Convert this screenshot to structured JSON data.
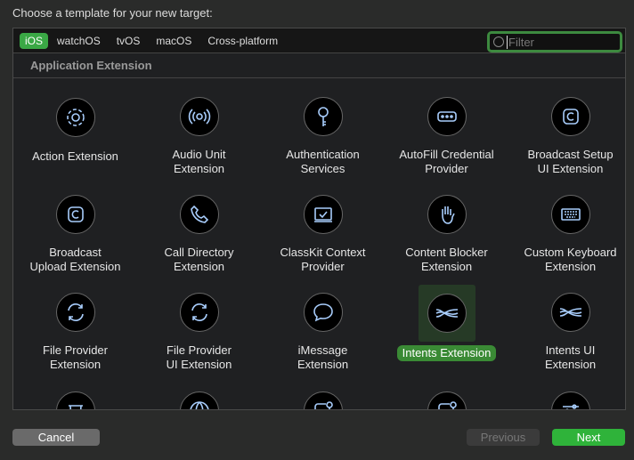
{
  "title": "Choose a template for your new target:",
  "tabs": [
    "iOS",
    "watchOS",
    "tvOS",
    "macOS",
    "Cross-platform"
  ],
  "filter": {
    "placeholder": "Filter",
    "value": ""
  },
  "section": "Application Extension",
  "templates": [
    {
      "label": "Action Extension",
      "icon": "gear-icon"
    },
    {
      "label": "Audio Unit\nExtension",
      "icon": "audio-waves-icon"
    },
    {
      "label": "Authentication\nServices",
      "icon": "key-icon"
    },
    {
      "label": "AutoFill Credential\nProvider",
      "icon": "password-dots-icon"
    },
    {
      "label": "Broadcast Setup\nUI Extension",
      "icon": "broadcast-icon"
    },
    {
      "label": "Broadcast\nUpload Extension",
      "icon": "broadcast-icon"
    },
    {
      "label": "Call Directory\nExtension",
      "icon": "phone-icon"
    },
    {
      "label": "ClassKit Context\nProvider",
      "icon": "classkit-icon"
    },
    {
      "label": "Content Blocker\nExtension",
      "icon": "hand-icon"
    },
    {
      "label": "Custom Keyboard\nExtension",
      "icon": "keyboard-icon"
    },
    {
      "label": "File Provider\nExtension",
      "icon": "sync-icon"
    },
    {
      "label": "File Provider\nUI Extension",
      "icon": "sync-icon"
    },
    {
      "label": "iMessage\nExtension",
      "icon": "message-bubble-icon"
    },
    {
      "label": "Intents Extension",
      "icon": "intents-waves-icon",
      "selected": true
    },
    {
      "label": "Intents UI\nExtension",
      "icon": "intents-waves-icon"
    },
    {
      "label": "",
      "icon": "trash-icon"
    },
    {
      "label": "",
      "icon": "globe-icon"
    },
    {
      "label": "",
      "icon": "notification-icon"
    },
    {
      "label": "",
      "icon": "notification-icon"
    },
    {
      "label": "",
      "icon": "sliders-icon"
    }
  ],
  "buttons": {
    "cancel": "Cancel",
    "previous": "Previous",
    "next": "Next"
  },
  "colors": {
    "accent": "#2fb33a",
    "icon": "#a8cdfc"
  }
}
